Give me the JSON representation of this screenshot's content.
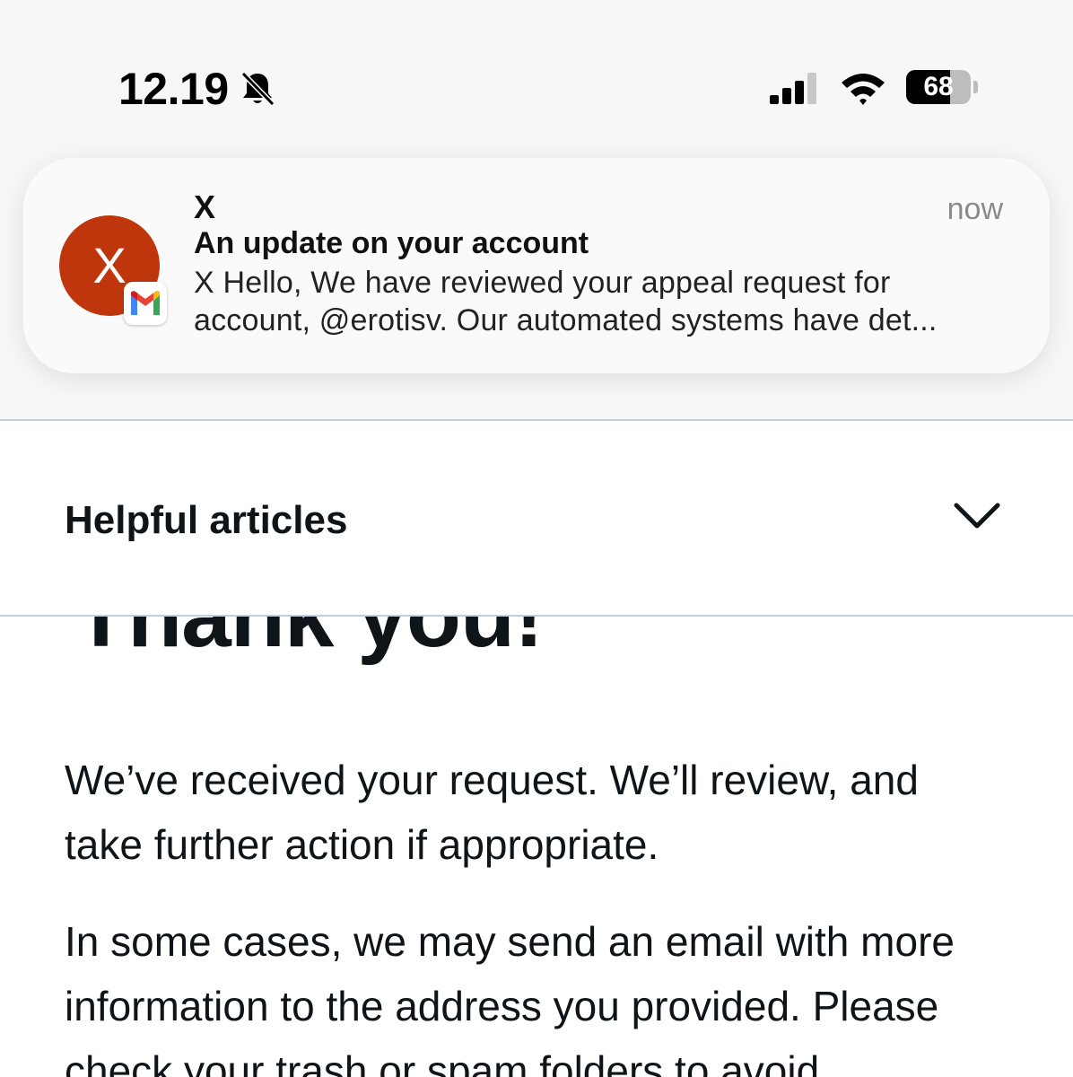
{
  "status_bar": {
    "time": "12.19",
    "battery_percent": "68",
    "battery_level": 0.68,
    "icons": [
      "bell-slash-icon",
      "signal-icon",
      "wifi-icon",
      "battery-icon"
    ]
  },
  "notification": {
    "avatar_letter": "X",
    "sender": "X",
    "time": "now",
    "subject": "An update on your account",
    "body_lines": [
      "X Hello, We have reviewed your appeal request for",
      "account, @erotisv. Our automated systems have det..."
    ],
    "app_badge": "gmail-icon",
    "avatar_color": "#c0360c"
  },
  "helpful_articles": {
    "title": "Helpful articles",
    "icon": "chevron-down-icon"
  },
  "main": {
    "heading": "Thank you!",
    "paragraph1_lines": [
      "We’ve received your request. We’ll review, and",
      "take further action if appropriate."
    ],
    "paragraph2_lines": [
      "In some cases, we may send an email with more",
      "information to the address you provided. Please",
      "check your trash or spam folders to avoid"
    ]
  }
}
